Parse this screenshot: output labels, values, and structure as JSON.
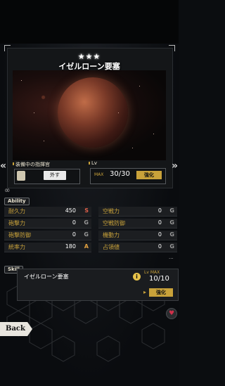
{
  "ship": {
    "stars": "★★★",
    "name": "イゼルローン要塞"
  },
  "commander": {
    "label": "装備中の指揮官",
    "unequip_label": "外す"
  },
  "level": {
    "label": "Lv",
    "max_tag": "MAX",
    "value": "30/30",
    "enhance_label": "強化"
  },
  "overflow_mark": "00",
  "ability": {
    "tab_label": "Ability",
    "stats": [
      {
        "name": "耐久力",
        "value": "450",
        "rank": "S",
        "rank_color": "#e0604a"
      },
      {
        "name": "空戦力",
        "value": "0",
        "rank": "G",
        "rank_color": "#9a9a9a"
      },
      {
        "name": "砲撃力",
        "value": "0",
        "rank": "G",
        "rank_color": "#9a9a9a"
      },
      {
        "name": "空戦防御",
        "value": "0",
        "rank": "G",
        "rank_color": "#9a9a9a"
      },
      {
        "name": "砲撃防御",
        "value": "0",
        "rank": "G",
        "rank_color": "#9a9a9a"
      },
      {
        "name": "機動力",
        "value": "0",
        "rank": "G",
        "rank_color": "#9a9a9a"
      },
      {
        "name": "統率力",
        "value": "180",
        "rank": "A",
        "rank_color": "#e0a040"
      },
      {
        "name": "占領値",
        "value": "0",
        "rank": "G",
        "rank_color": "#9a9a9a"
      }
    ],
    "more": "..."
  },
  "skill": {
    "tab_label": "Skill",
    "name": "イゼルローン要塞",
    "info_glyph": "i",
    "lv_label": "Lv",
    "max_tag": "MAX",
    "lv_value": "10/10",
    "enhance_label": "強化"
  },
  "favorite_icon": "heart-icon",
  "back_label": "Back",
  "colors": {
    "accent_gold": "#c9a23a",
    "rank_s": "#e0604a",
    "rank_a": "#e0a040",
    "rank_g": "#9a9a9a"
  }
}
